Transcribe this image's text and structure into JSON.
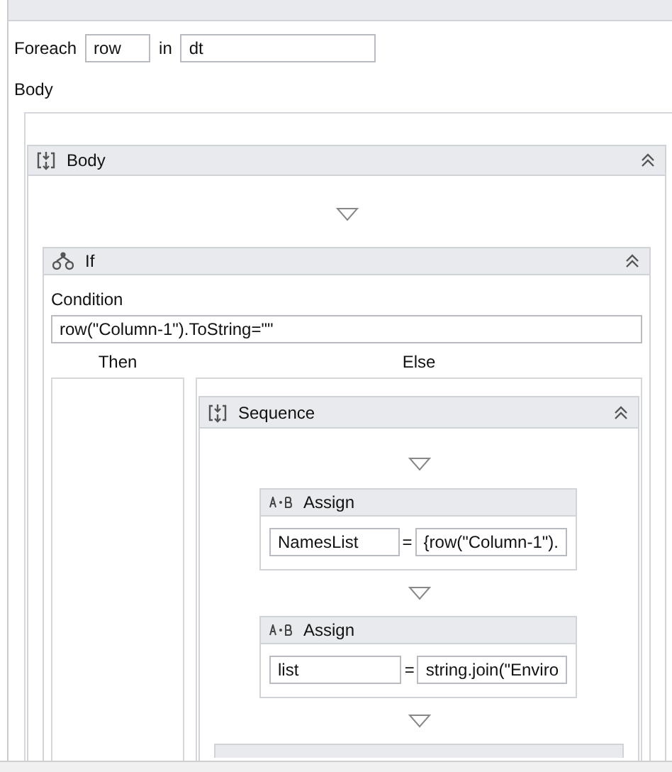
{
  "foreach": {
    "label": "Foreach",
    "item": "row",
    "in_label": "in",
    "collection": "dt",
    "body_label": "Body"
  },
  "body": {
    "title": "Body"
  },
  "if": {
    "title": "If",
    "condition_label": "Condition",
    "condition": "row(\"Column-1\").ToString=\"\"",
    "then_label": "Then",
    "else_label": "Else"
  },
  "sequence": {
    "title": "Sequence",
    "activities": [
      {
        "kind": "assign",
        "title": "Assign",
        "to": "NamesList",
        "operator": "=",
        "value": "{row(\"Column-1\")."
      },
      {
        "kind": "assign",
        "title": "Assign",
        "to": "list",
        "operator": "=",
        "value": "string.join(\"Enviro"
      },
      {
        "kind": "collapsed"
      }
    ]
  }
}
